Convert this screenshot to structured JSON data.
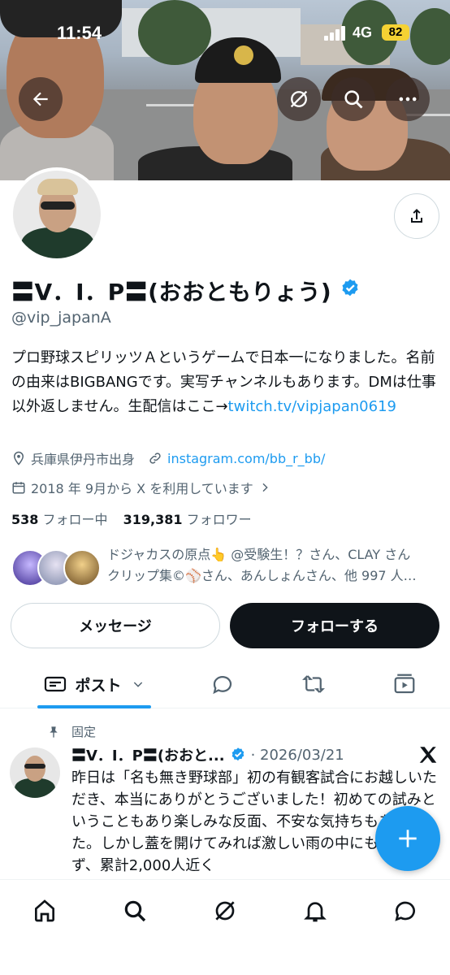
{
  "status_bar": {
    "time": "11:54",
    "network": "4G",
    "battery": "82"
  },
  "profile": {
    "display_name": "〓V．I．P〓(おおともりょう)",
    "handle": "@vip_japanA",
    "bio_text": "プロ野球スピリッツＡというゲームで日本一になりました。名前の由来はBIGBANGです。実写チャンネルもあります。DMは仕事以外返しません。生配信はここ→",
    "bio_link": "twitch.tv/vipjapan0619",
    "location": "兵庫県伊丹市出身",
    "website": "instagram.com/bb_r_bb/",
    "joined": "2018 年 9月から X を利用しています",
    "following_count": "538",
    "following_label": "フォロー中",
    "followers_count": "319,381",
    "followers_label": "フォロワー",
    "known_followers_line1": "ドジャカスの原点👆 @受験生！？さん、CLAY さん",
    "known_followers_line2": "クリップ集©⚾️さん、あんしょんさん、他 997 人…"
  },
  "actions": {
    "message_label": "メッセージ",
    "follow_label": "フォローする"
  },
  "tabs": {
    "posts_label": "ポスト"
  },
  "pinned_post": {
    "pinned_label": "固定",
    "author_name": "〓V．I．P〓(おおと...",
    "date": "· 2026/03/21",
    "text": "昨日は「名も無き野球部」初の有観客試合にお越しいただき、本当にありがとうございました！初めての試みということもあり楽しみな反面、不安な気持ちもありました。しかし蓋を開けてみれば激しい雨の中にもかかわらず、累計2,000人近く"
  },
  "colors": {
    "accent": "#1d9bf0",
    "text": "#0f1419",
    "secondary": "#536471"
  },
  "icons": [
    "back-icon",
    "grok-icon",
    "search-icon",
    "more-icon",
    "share-icon",
    "verified-icon",
    "location-icon",
    "link-icon",
    "calendar-icon",
    "chevron-right-icon",
    "posts-icon",
    "chevron-down-icon",
    "replies-icon",
    "reposts-icon",
    "media-icon",
    "pin-icon",
    "x-logo-icon",
    "compose-icon",
    "home-icon",
    "explore-icon",
    "notifications-icon",
    "messages-icon"
  ]
}
